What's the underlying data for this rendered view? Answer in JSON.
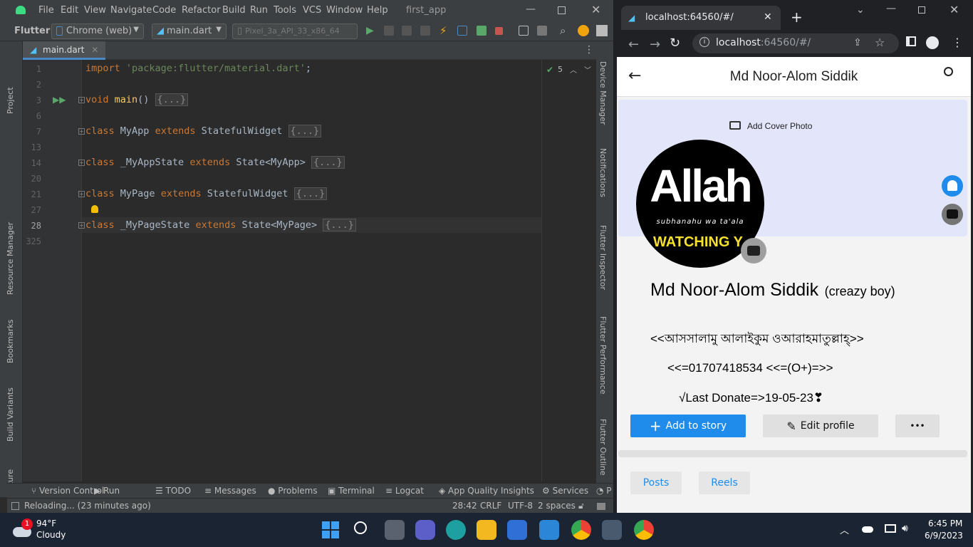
{
  "ide": {
    "menu": [
      "File",
      "Edit",
      "View",
      "Navigate",
      "Code",
      "Refactor",
      "Build",
      "Run",
      "Tools",
      "VCS",
      "Window",
      "Help"
    ],
    "project_title": "first_app",
    "toolbar": {
      "flutter_label": "Flutter",
      "device_target": "Chrome (web)",
      "run_config": "main.dart",
      "emulator": "Pixel_3a_API_33_x86_64"
    },
    "left_tools": [
      "Project",
      "Resource Manager",
      "Bookmarks",
      "Build Variants",
      "Structure"
    ],
    "right_tools": [
      "Device Manager",
      "Notifications",
      "Flutter Inspector",
      "Flutter Performance",
      "Flutter Outline"
    ],
    "tab_name": "main.dart",
    "inspections_count": "5",
    "lines": [
      {
        "num": "1",
        "code": "import 'package:flutter/material.dart';"
      },
      {
        "num": "2",
        "code": ""
      },
      {
        "num": "3",
        "code": "void main() {...}"
      },
      {
        "num": "6",
        "code": ""
      },
      {
        "num": "7",
        "code": "class MyApp extends StatefulWidget {...}"
      },
      {
        "num": "13",
        "code": ""
      },
      {
        "num": "14",
        "code": "class _MyAppState extends State<MyApp> {...}"
      },
      {
        "num": "20",
        "code": ""
      },
      {
        "num": "21",
        "code": "class MyPage extends StatefulWidget {...}"
      },
      {
        "num": "27",
        "code": ""
      },
      {
        "num": "28",
        "code": "class _MyPageState extends State<MyPage> {...}"
      },
      {
        "num": "325",
        "code": ""
      }
    ],
    "bottom_tools": [
      "Version Control",
      "Run",
      "TODO",
      "Messages",
      "Problems",
      "Terminal",
      "Logcat",
      "App Quality Insights",
      "Services"
    ],
    "status": {
      "message": "Reloading... (23 minutes ago)",
      "position": "28:42",
      "line_sep": "CRLF",
      "encoding": "UTF-8",
      "indent": "2 spaces"
    }
  },
  "browser": {
    "tab_title": "localhost:64560/#/",
    "url_host": "localhost",
    "url_rest": ":64560/#/"
  },
  "app": {
    "title": "Md Noor-Alom Siddik",
    "add_cover_label": "Add Cover Photo",
    "avatar_text": "Allah",
    "avatar_sub": "subhanahu wa ta'ala",
    "avatar_banner": "WATCHING Y",
    "profile_name": "Md Noor-Alom Siddik",
    "nickname": "(creazy boy)",
    "greeting": "<<আসসালামু আলাইকুম ওআরাহমাতুল্লাহ্>>",
    "phone": "<<=01707418534 <<=(O+)=>>",
    "donate": "√Last Donate=>19-05-23❣",
    "add_story_label": "Add to story",
    "edit_profile_label": "Edit profile",
    "more_label": "•••",
    "tabs": [
      "Posts",
      "Reels"
    ]
  },
  "taskbar": {
    "weather_temp": "94°F",
    "weather_desc": "Cloudy",
    "weather_badge": "1",
    "time": "6:45 PM",
    "date": "6/9/2023"
  },
  "colors": {
    "accent_blue": "#1f8ceb",
    "cover_bg": "#e3e5fb",
    "ide_bg": "#2b2b2b"
  }
}
